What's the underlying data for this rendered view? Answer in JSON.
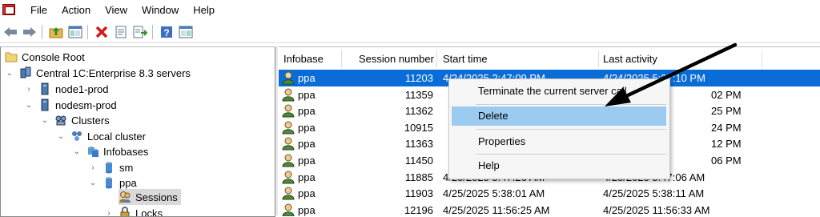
{
  "menu": [
    "File",
    "Action",
    "View",
    "Window",
    "Help"
  ],
  "toolbar": {
    "icons": [
      "back-arrow-icon",
      "forward-arrow-icon",
      "up-folder-icon",
      "show-hide-tree-icon",
      "delete-icon",
      "properties-icon",
      "export-list-icon",
      "help-icon",
      "show-hide-action-pane-icon"
    ]
  },
  "tree": {
    "root": "Console Root",
    "servers": "Central 1C:Enterprise 8.3 servers",
    "node1": "node1-prod",
    "nodesm": "nodesm-prod",
    "clusters": "Clusters",
    "local_cluster": "Local cluster",
    "infobases": "Infobases",
    "sm": "sm",
    "ppa": "ppa",
    "sessions": "Sessions",
    "locks": "Locks"
  },
  "grid": {
    "columns": [
      "Infobase",
      "Session number",
      "Start time",
      "Last activity"
    ],
    "rows": [
      {
        "infobase": "ppa",
        "session": "11203",
        "start": "4/24/2025 2:47:09 PM",
        "last": "4/24/2025 5:37:10 PM"
      },
      {
        "infobase": "ppa",
        "session": "11359",
        "start": "",
        "last": "02 PM"
      },
      {
        "infobase": "ppa",
        "session": "11362",
        "start": "",
        "last": "25 PM"
      },
      {
        "infobase": "ppa",
        "session": "10915",
        "start": "",
        "last": "24 PM"
      },
      {
        "infobase": "ppa",
        "session": "11363",
        "start": "",
        "last": "12 PM"
      },
      {
        "infobase": "ppa",
        "session": "11450",
        "start": "",
        "last": "06 PM"
      },
      {
        "infobase": "ppa",
        "session": "11885",
        "start": "4/25/2025 5:47:26 AM",
        "last": "4/25/2025 5:47:06 AM"
      },
      {
        "infobase": "ppa",
        "session": "11903",
        "start": "4/25/2025 5:38:01 AM",
        "last": "4/25/2025 5:38:11 AM"
      },
      {
        "infobase": "ppa",
        "session": "12196",
        "start": "4/25/2025 11:56:25 AM",
        "last": "4/25/2025 11:56:33 AM"
      }
    ]
  },
  "context_menu": {
    "terminate": "Terminate the current server call",
    "delete": "Delete",
    "properties": "Properties",
    "help": "Help"
  },
  "colors": {
    "selection": "#0a6cd6",
    "menu_highlight": "#9ccbf1",
    "annotation_arrow": "#000000"
  }
}
